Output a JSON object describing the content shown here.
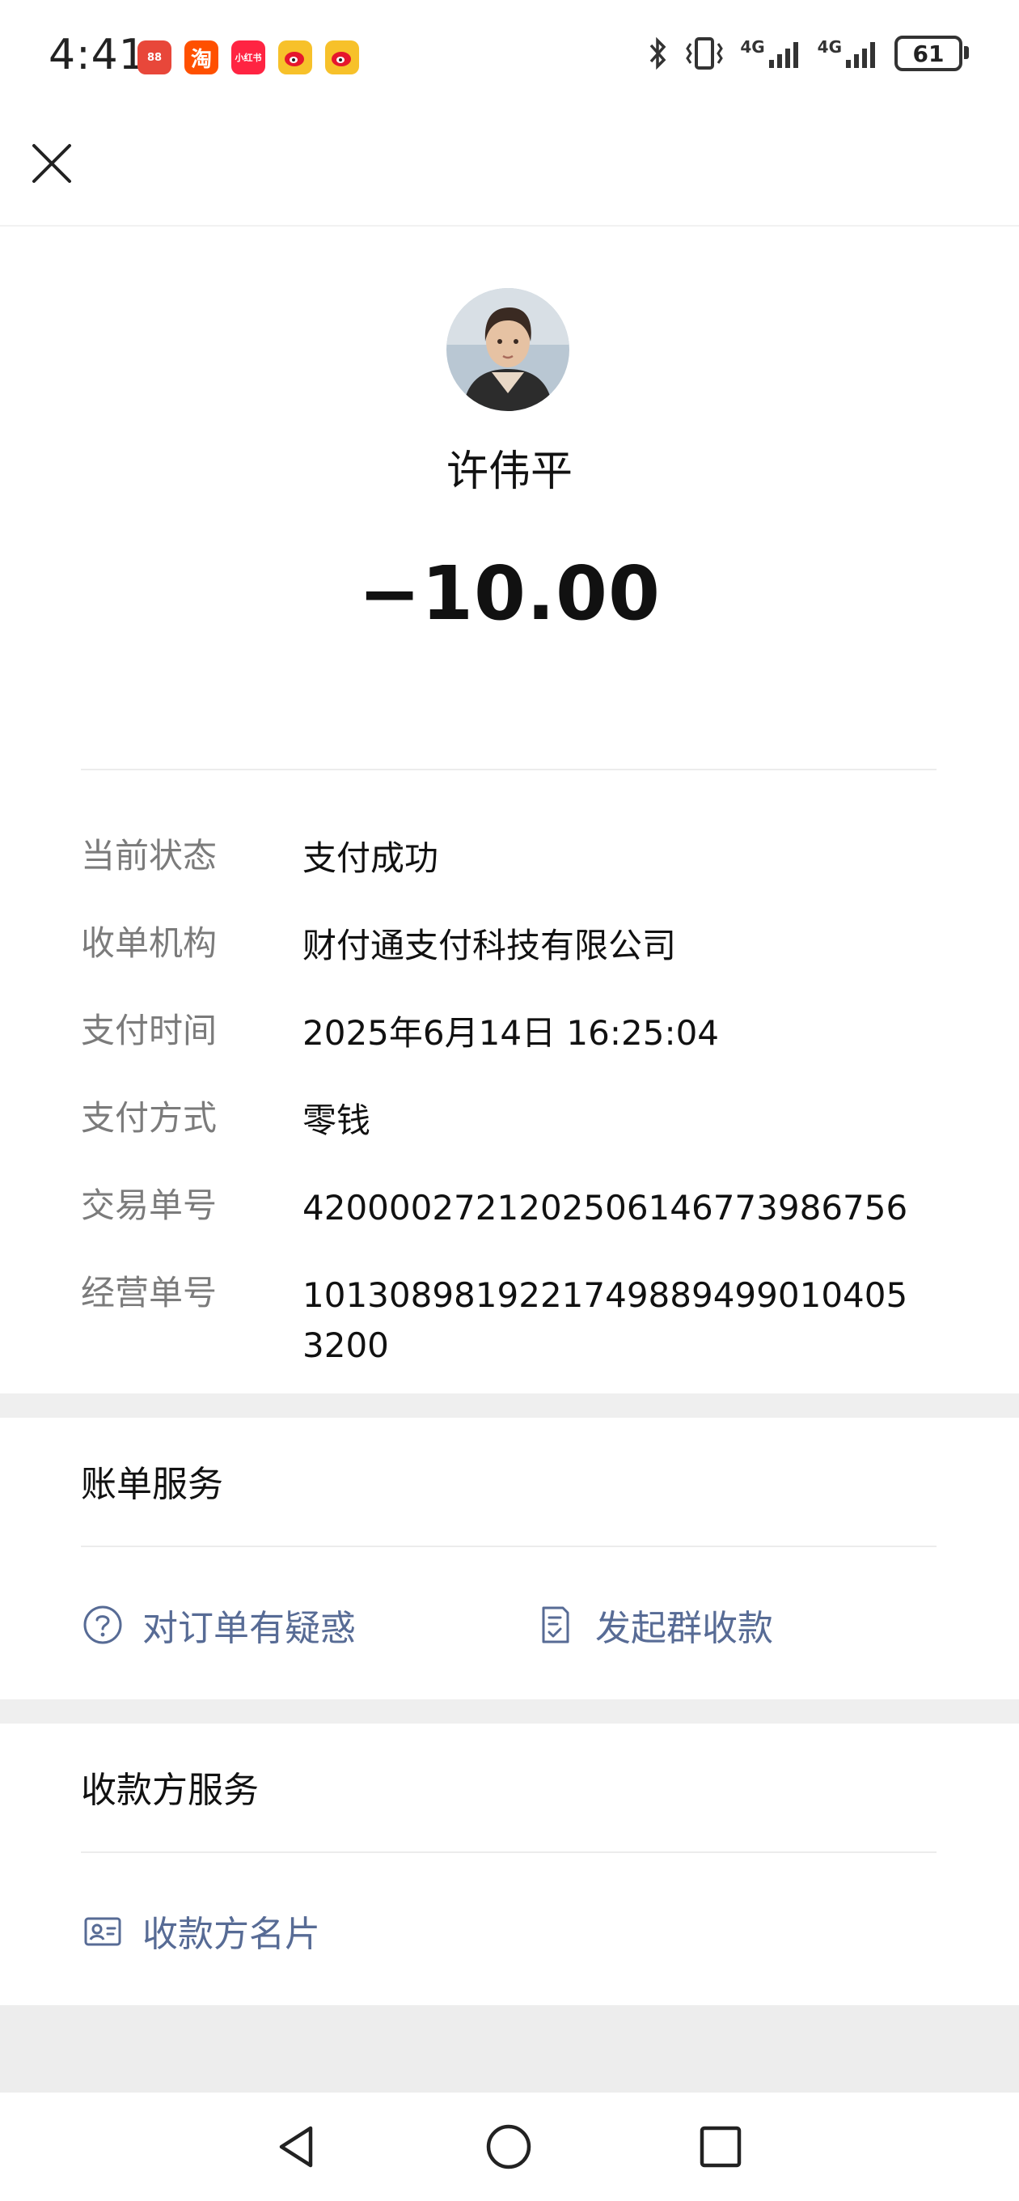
{
  "status_bar": {
    "time": "4:41",
    "battery": "61",
    "signal_1": "4G",
    "signal_2": "4G",
    "app_icons": [
      {
        "name": "app-icon-1",
        "label": "88",
        "color": "#e8473a"
      },
      {
        "name": "taobao-icon",
        "label": "淘",
        "color": "#ff5000"
      },
      {
        "name": "xiaohongshu-icon",
        "label": "小红书",
        "color": "#ff2442"
      },
      {
        "name": "weibo-icon",
        "label": "",
        "color": "#f7c12a"
      },
      {
        "name": "weibo-icon-2",
        "label": "",
        "color": "#f7c12a"
      }
    ]
  },
  "payee": {
    "name": "许伟平",
    "amount": "−10.00"
  },
  "details": [
    {
      "label": "当前状态",
      "value": "支付成功"
    },
    {
      "label": "收单机构",
      "value": "财付通支付科技有限公司"
    },
    {
      "label": "支付时间",
      "value": "2025年6月14日 16:25:04"
    },
    {
      "label": "支付方式",
      "value": "零钱"
    },
    {
      "label": "交易单号",
      "value": "4200002721202506146773986756"
    },
    {
      "label": "经营单号",
      "value": "1013089819221749889499010405320​0"
    }
  ],
  "bill_services": {
    "title": "账单服务",
    "order_question": "对订单有疑惑",
    "group_collect": "发起群收款"
  },
  "payee_services": {
    "title": "收款方服务",
    "payee_card": "收款方名片"
  },
  "colors": {
    "link": "#576b95",
    "label": "#7b7b7b",
    "band": "#efefef"
  }
}
